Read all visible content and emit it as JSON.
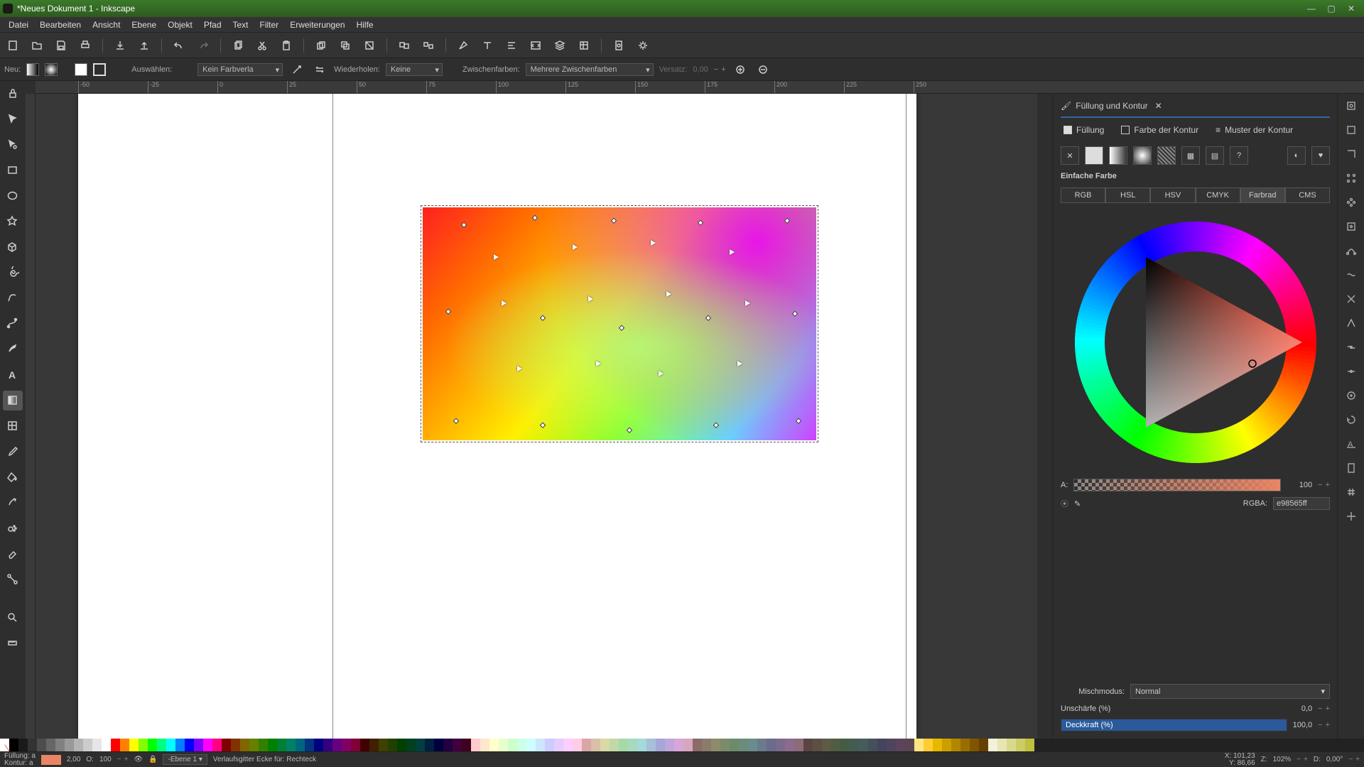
{
  "window": {
    "title": "*Neues Dokument 1 - Inkscape"
  },
  "menu": [
    "Datei",
    "Bearbeiten",
    "Ansicht",
    "Ebene",
    "Objekt",
    "Pfad",
    "Text",
    "Filter",
    "Erweiterungen",
    "Hilfe"
  ],
  "toolbar2": {
    "neu_label": "Neu:",
    "auswahl_label": "Auswählen:",
    "gradient_type": "Kein Farbverla",
    "wiederholen_label": "Wiederholen:",
    "wiederholen_value": "Keine",
    "zwischen_label": "Zwischenfarben:",
    "zwischen_value": "Mehrere Zwischenfarben",
    "versatz_label": "Versatz:",
    "versatz_value": "0,00"
  },
  "ruler_ticks": [
    "-50",
    "-25",
    "0",
    "25",
    "50",
    "75",
    "100",
    "125",
    "150",
    "175",
    "200",
    "225",
    "250"
  ],
  "panel": {
    "title": "Füllung und Kontur",
    "tab_fill": "Füllung",
    "tab_stroke_paint": "Farbe der Kontur",
    "tab_stroke_style": "Muster der Kontur",
    "flat_label": "Einfache Farbe",
    "modes": {
      "rgb": "RGB",
      "hsl": "HSL",
      "hsv": "HSV",
      "cmyk": "CMYK",
      "wheel": "Farbrad",
      "cms": "CMS"
    },
    "alpha_label": "A:",
    "alpha_value": "100",
    "rgba_label": "RGBA:",
    "rgba_value": "e98565ff",
    "blend_label": "Mischmodus:",
    "blend_value": "Normal",
    "blur_label": "Unschärfe (%)",
    "blur_value": "0,0",
    "opacity_label": "Deckkraft (%)",
    "opacity_value": "100,0"
  },
  "status": {
    "fill_label": "Füllung:",
    "stroke_label": "Kontur:",
    "fill_a": "a",
    "stroke_a": "a",
    "stroke_w": "2,00",
    "o_label": "O:",
    "o_value": "100",
    "layer_prefix": "-Ebene 1",
    "hint": "Verlaufsgitter Ecke für: Rechteck",
    "x_label": "X:",
    "x_value": "101,23",
    "y_label": "Y:",
    "y_value": "86,66",
    "z_label": "Z:",
    "z_value": "102%",
    "d_label": "D:",
    "d_value": "0,00°"
  },
  "palette_colors": [
    "#000",
    "#1a1a1a",
    "#333",
    "#4d4d4d",
    "#666",
    "#808080",
    "#999",
    "#b3b3b3",
    "#ccc",
    "#e6e6e6",
    "#fff",
    "#f00",
    "#ff8000",
    "#ff0",
    "#80ff00",
    "#0f0",
    "#00ff80",
    "#0ff",
    "#0080ff",
    "#00f",
    "#8000ff",
    "#f0f",
    "#ff0080",
    "#800000",
    "#803300",
    "#806600",
    "#668000",
    "#338000",
    "#008000",
    "#008033",
    "#008066",
    "#006680",
    "#003380",
    "#000080",
    "#330080",
    "#660080",
    "#800066",
    "#800033",
    "#400000",
    "#402000",
    "#404000",
    "#204000",
    "#004000",
    "#004020",
    "#004040",
    "#002040",
    "#000040",
    "#200040",
    "#400040",
    "#400020",
    "#ffcccc",
    "#ffe6cc",
    "#ffffcc",
    "#e6ffcc",
    "#ccffcc",
    "#ccffe6",
    "#ccffff",
    "#cce6ff",
    "#ccccff",
    "#e6ccff",
    "#ffccff",
    "#ffcce6",
    "#d9a6a6",
    "#d9c0a6",
    "#d9d9a6",
    "#c0d9a6",
    "#a6d9a6",
    "#a6d9c0",
    "#a6d9d9",
    "#a6c0d9",
    "#a6a6d9",
    "#c0a6d9",
    "#d9a6d9",
    "#d9a6c0",
    "#8c6b6b",
    "#8c7a6b",
    "#8c8c6b",
    "#7a8c6b",
    "#6b8c6b",
    "#6b8c7a",
    "#6b8c8c",
    "#6b7a8c",
    "#6b6b8c",
    "#7a6b8c",
    "#8c6b8c",
    "#8c6b7a",
    "#5c4444",
    "#5c5044",
    "#5c5c44",
    "#505c44",
    "#445c44",
    "#445c50",
    "#445c5c",
    "#44505c",
    "#44445c",
    "#50445c",
    "#5c445c",
    "#5c4450",
    "#ffe680",
    "#ffcc33",
    "#e6b800",
    "#cc9f00",
    "#b38600",
    "#996d00",
    "#805500",
    "#664000",
    "#f2f2d9",
    "#e6e6b3",
    "#d9d98c",
    "#cccc66",
    "#bfbf40"
  ]
}
